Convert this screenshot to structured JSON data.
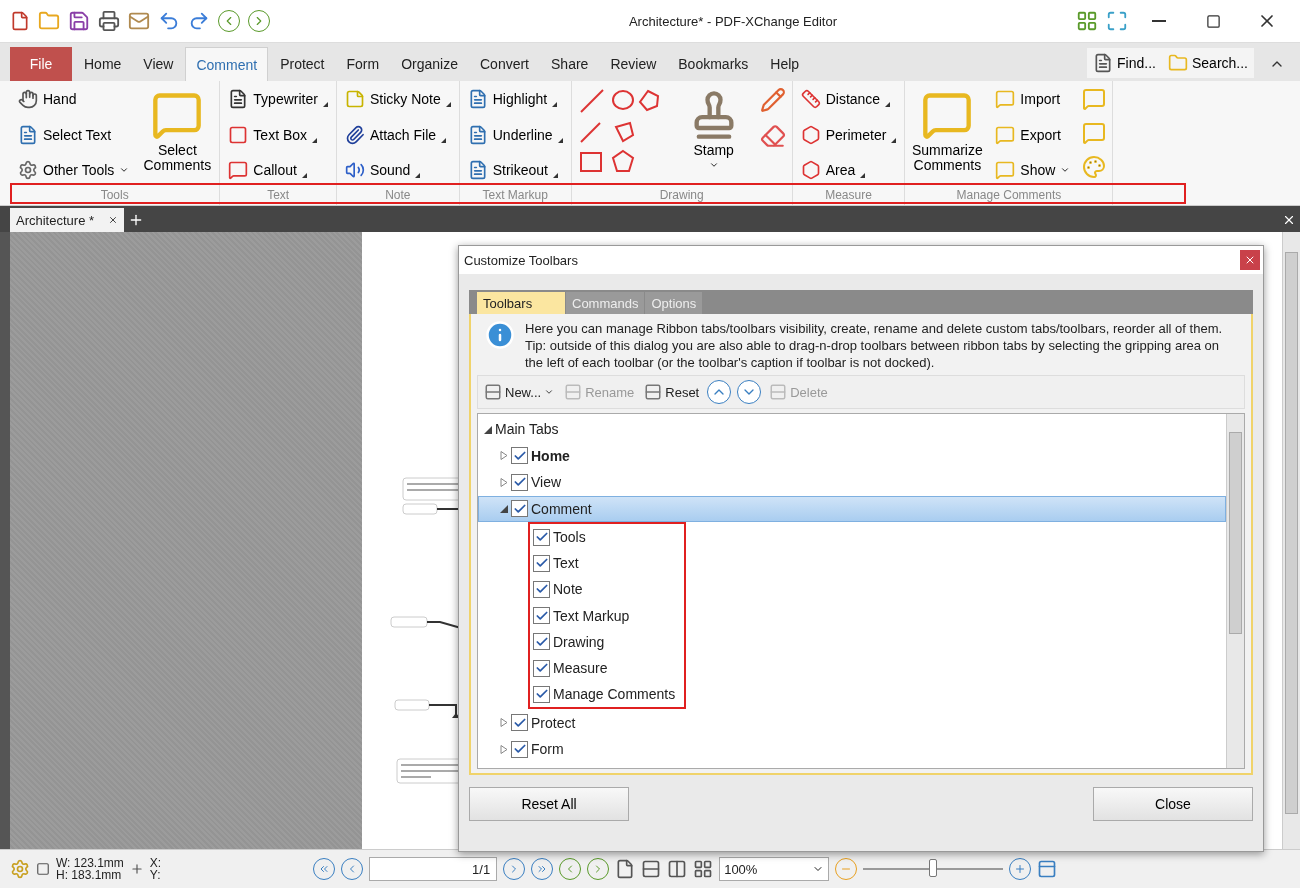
{
  "window": {
    "title": "Architecture* - PDF-XChange Editor"
  },
  "menu_tabs": [
    {
      "label": "File",
      "kind": "file",
      "selected": false
    },
    {
      "label": "Home",
      "kind": "tab",
      "selected": false
    },
    {
      "label": "View",
      "kind": "tab",
      "selected": false
    },
    {
      "label": "Comment",
      "kind": "tab",
      "selected": true
    },
    {
      "label": "Protect",
      "kind": "tab",
      "selected": false
    },
    {
      "label": "Form",
      "kind": "tab",
      "selected": false
    },
    {
      "label": "Organize",
      "kind": "tab",
      "selected": false
    },
    {
      "label": "Convert",
      "kind": "tab",
      "selected": false
    },
    {
      "label": "Share",
      "kind": "tab",
      "selected": false
    },
    {
      "label": "Review",
      "kind": "tab",
      "selected": false
    },
    {
      "label": "Bookmarks",
      "kind": "tab",
      "selected": false
    },
    {
      "label": "Help",
      "kind": "tab",
      "selected": false
    }
  ],
  "find_buttons": [
    "Find...",
    "Search..."
  ],
  "ribbon": {
    "marked": true,
    "groups": [
      {
        "caption": "Tools",
        "columns": [
          {
            "kind": "small",
            "items": [
              {
                "label": "Hand",
                "kind": "plain"
              },
              {
                "label": "Select Text",
                "kind": "plain"
              },
              {
                "label": "Other Tools",
                "kind": "dropdown"
              }
            ]
          },
          {
            "kind": "large",
            "items": [
              {
                "label": "Select Comments",
                "kind": "plain"
              }
            ]
          }
        ]
      },
      {
        "caption": "Text",
        "columns": [
          {
            "kind": "small",
            "items": [
              {
                "label": "Typewriter",
                "kind": "split"
              },
              {
                "label": "Text Box",
                "kind": "split"
              },
              {
                "label": "Callout",
                "kind": "split"
              }
            ]
          }
        ]
      },
      {
        "caption": "Note",
        "columns": [
          {
            "kind": "small",
            "items": [
              {
                "label": "Sticky Note",
                "kind": "split"
              },
              {
                "label": "Attach File",
                "kind": "split"
              },
              {
                "label": "Sound",
                "kind": "split"
              }
            ]
          }
        ]
      },
      {
        "caption": "Text Markup",
        "columns": [
          {
            "kind": "small",
            "items": [
              {
                "label": "Highlight",
                "kind": "split"
              },
              {
                "label": "Underline",
                "kind": "split"
              },
              {
                "label": "Strikeout",
                "kind": "split"
              }
            ]
          }
        ]
      },
      {
        "caption": "Drawing",
        "columns": [
          {
            "kind": "shapes"
          },
          {
            "kind": "large",
            "items": [
              {
                "label": "Stamp",
                "kind": "dropdown"
              }
            ]
          },
          {
            "kind": "icons"
          }
        ]
      },
      {
        "caption": "Measure",
        "columns": [
          {
            "kind": "small",
            "items": [
              {
                "label": "Distance",
                "kind": "split"
              },
              {
                "label": "Perimeter",
                "kind": "split"
              },
              {
                "label": "Area",
                "kind": "split"
              }
            ]
          }
        ]
      },
      {
        "caption": "Manage Comments",
        "columns": [
          {
            "kind": "large",
            "items": [
              {
                "label": "Summarize Comments",
                "kind": "plain"
              }
            ]
          },
          {
            "kind": "small",
            "items": [
              {
                "label": "Import",
                "kind": "plain"
              },
              {
                "label": "Export",
                "kind": "plain"
              },
              {
                "label": "Show",
                "kind": "dropdown"
              }
            ]
          },
          {
            "kind": "icons"
          }
        ]
      }
    ]
  },
  "doc_tabs": [
    {
      "label": "Architecture *",
      "selected": true
    }
  ],
  "dialog": {
    "title": "Customize Toolbars",
    "tabs": [
      {
        "label": "Toolbars",
        "selected": true
      },
      {
        "label": "Commands",
        "selected": false
      },
      {
        "label": "Options",
        "selected": false
      }
    ],
    "info": "Here you can manage Ribbon tabs/toolbars visibility, create, rename and delete custom tabs/toolbars, reorder all of them. Tip: outside of this dialog you are also able to drag-n-drop toolbars between ribbon tabs by selecting the gripping area on the left of each toolbar (or the toolbar's caption if toolbar is not docked).",
    "toolbar": [
      {
        "label": "New...",
        "kind": "new",
        "disabled": false
      },
      {
        "label": "Rename",
        "kind": "rename",
        "disabled": true
      },
      {
        "label": "Reset",
        "kind": "reset",
        "disabled": false
      },
      {
        "kind": "up",
        "disabled": false
      },
      {
        "kind": "down",
        "disabled": false
      },
      {
        "label": "Delete",
        "kind": "delete",
        "disabled": true
      }
    ],
    "tree": [
      {
        "label": "Main Tabs",
        "expanded": true,
        "children": [
          {
            "label": "Home",
            "checked": true,
            "bold": true,
            "expanded": false,
            "selected": false,
            "marked": false
          },
          {
            "label": "View",
            "checked": true,
            "bold": false,
            "expanded": false,
            "selected": false,
            "marked": false
          },
          {
            "label": "Comment",
            "checked": true,
            "bold": false,
            "expanded": true,
            "selected": true,
            "marked": true,
            "children": [
              {
                "label": "Tools",
                "checked": true
              },
              {
                "label": "Text",
                "checked": true
              },
              {
                "label": "Note",
                "checked": true
              },
              {
                "label": "Text Markup",
                "checked": true
              },
              {
                "label": "Drawing",
                "checked": true
              },
              {
                "label": "Measure",
                "checked": true
              },
              {
                "label": "Manage Comments",
                "checked": true
              }
            ]
          },
          {
            "label": "Protect",
            "checked": true,
            "bold": false,
            "expanded": false,
            "selected": false,
            "marked": false
          },
          {
            "label": "Form",
            "checked": true,
            "bold": false,
            "expanded": false,
            "selected": false,
            "marked": false
          }
        ]
      }
    ],
    "buttons": [
      "Reset All",
      "Close"
    ]
  },
  "status_bar": {
    "width": "W: 123.1mm",
    "height": "H: 183.1mm",
    "x": "X:",
    "y": "Y:",
    "page": "1/1",
    "zoom": "100%",
    "zoom_slider": {
      "level": 0.5
    }
  }
}
